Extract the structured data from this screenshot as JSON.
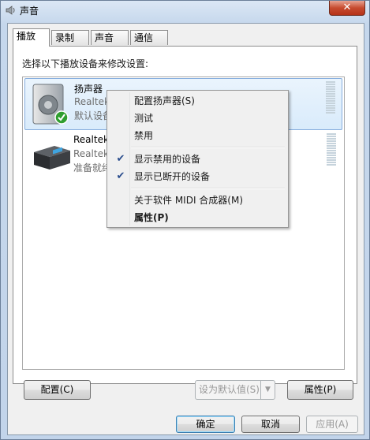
{
  "window": {
    "title": "声音",
    "close_label": "✕"
  },
  "tabs": [
    {
      "label": "播放",
      "active": true
    },
    {
      "label": "录制",
      "active": false
    },
    {
      "label": "声音",
      "active": false
    },
    {
      "label": "通信",
      "active": false
    }
  ],
  "instruction": "选择以下播放设备来修改设置:",
  "devices": [
    {
      "name": "扬声器",
      "driver": "Realtek",
      "status": "默认设备",
      "selected": true,
      "icon": "speaker-icon"
    },
    {
      "name": "Realtek",
      "driver": "Realtek",
      "status": "准备就绪",
      "selected": false,
      "icon": "receiver-icon"
    }
  ],
  "context_menu": {
    "items": [
      {
        "label": "配置扬声器(S)",
        "checked": false,
        "bold": false
      },
      {
        "label": "测试",
        "checked": false,
        "bold": false
      },
      {
        "label": "禁用",
        "checked": false,
        "bold": false
      },
      {
        "label": "显示禁用的设备",
        "checked": true,
        "bold": false
      },
      {
        "label": "显示已断开的设备",
        "checked": true,
        "bold": false
      },
      {
        "label": "关于软件 MIDI 合成器(M)",
        "checked": false,
        "bold": false
      },
      {
        "label": "属性(P)",
        "checked": false,
        "bold": true
      }
    ],
    "check_glyph": "✔"
  },
  "panel_buttons": {
    "configure": "配置(C)",
    "set_default": "设为默认值(S)",
    "properties": "属性(P)"
  },
  "dialog_buttons": {
    "ok": "确定",
    "cancel": "取消",
    "apply": "应用(A)"
  },
  "colors": {
    "selection": "#d9ebfb",
    "check": "#2a4d8d",
    "close": "#c74b2f"
  }
}
